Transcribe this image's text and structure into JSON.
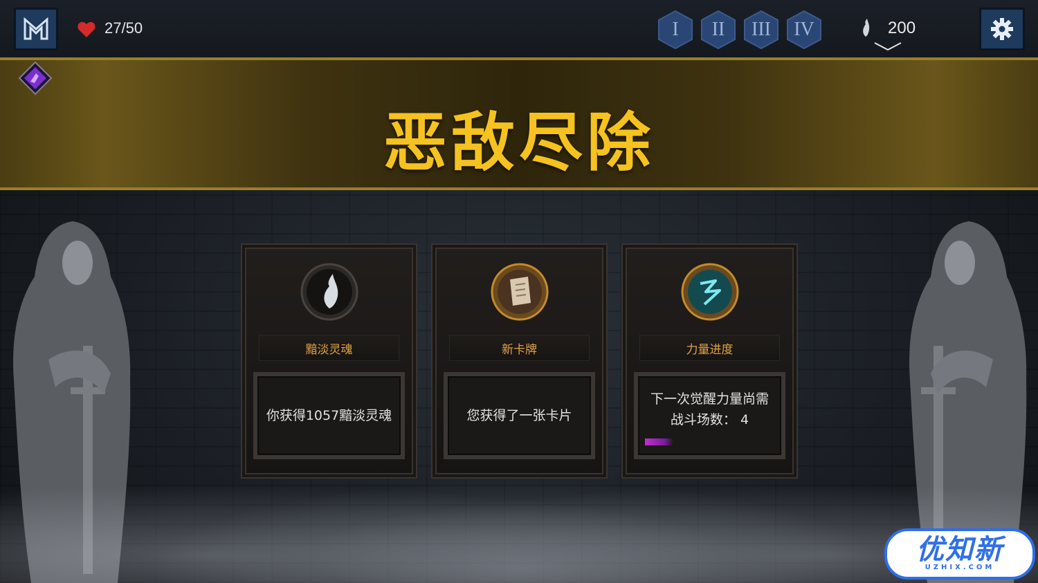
{
  "hud": {
    "health": "27/50",
    "tiers": [
      "I",
      "II",
      "III",
      "IV"
    ],
    "souls": "200"
  },
  "banner": {
    "title": "恶敌尽除"
  },
  "rewards": [
    {
      "icon": "soul-wisp-icon",
      "title": "黯淡灵魂",
      "lines": [
        "你获得1057黯淡灵魂"
      ]
    },
    {
      "icon": "card-scroll-icon",
      "title": "新卡牌",
      "lines": [
        "您获得了一张卡片"
      ]
    },
    {
      "icon": "power-rune-icon",
      "title": "力量进度",
      "lines": [
        "下一次觉醒力量尚需",
        "战斗场数： 4"
      ],
      "progress_fraction": 0.2
    }
  ],
  "watermark": {
    "main": "优知新",
    "sub": "UZHIX.COM"
  },
  "colors": {
    "gold": "#f5c21f",
    "card_title": "#e0a246",
    "button_blue": "#1e3a5c"
  }
}
